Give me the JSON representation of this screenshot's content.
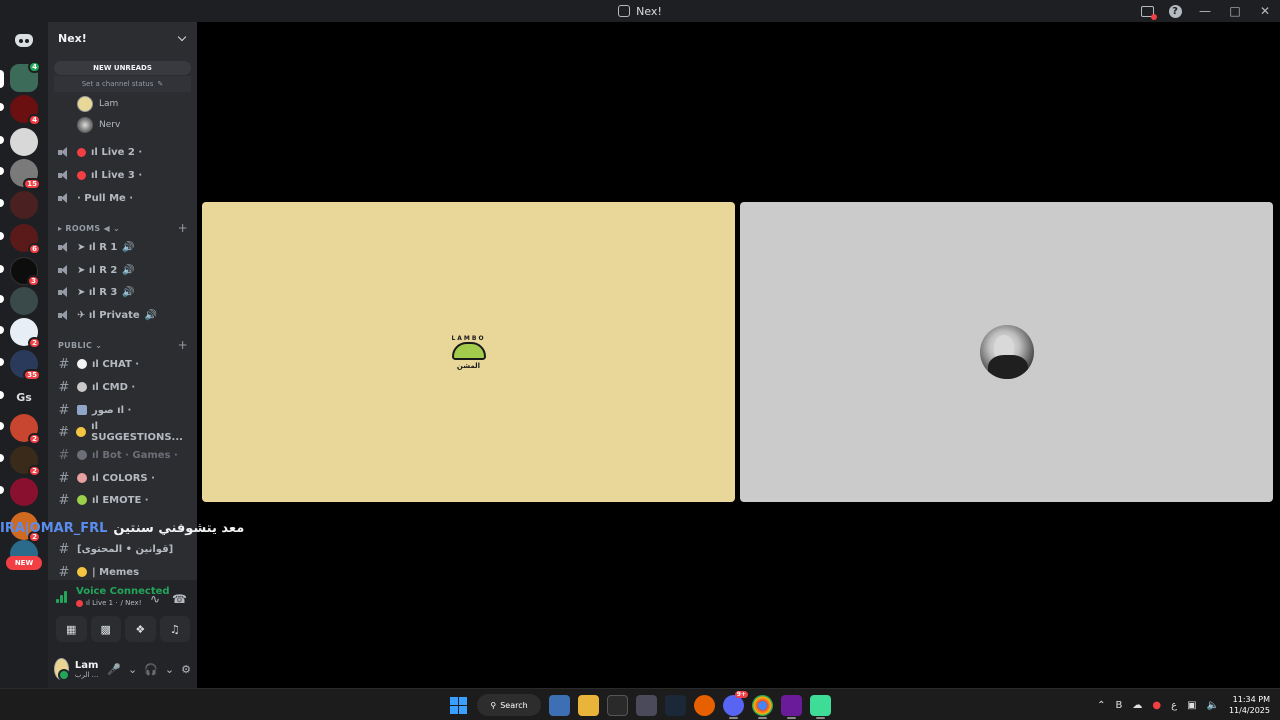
{
  "window": {
    "title": "Nex!"
  },
  "server": {
    "name": "Nex!"
  },
  "sidebar": {
    "new_unreads": "NEW UNREADS",
    "channel_status": "Set a channel status",
    "voice_users": [
      {
        "name": "Lam"
      },
      {
        "name": "Nerv"
      }
    ],
    "voice_channels": [
      {
        "label": "ıl Live 2 ·"
      },
      {
        "label": "ıl Live 3 ·"
      },
      {
        "label": "· Pull Me ·"
      }
    ],
    "rooms_category": "ROOMS ◀",
    "rooms": [
      {
        "label": "➤ ıl R 1"
      },
      {
        "label": "➤ ıl R 2"
      },
      {
        "label": "➤ ıl R 3"
      },
      {
        "label": "✈ ıl Private"
      }
    ],
    "public_category": "PUBLIC",
    "text_channels": [
      {
        "label": "ıl CHAT ·",
        "muted": false
      },
      {
        "label": "ıl CMD ·",
        "muted": false
      },
      {
        "label": "صور ıl ·",
        "muted": false
      },
      {
        "label": "ıl SUGGESTIONS...",
        "muted": false
      },
      {
        "label": "ıl Bot · Games ·",
        "muted": true
      },
      {
        "label": "ıl COLORS ·",
        "muted": false
      },
      {
        "label": "ıl EMOTE ·",
        "muted": false
      },
      {
        "label": "[قوانين • المحتوى]",
        "muted": false
      },
      {
        "label": "| Memes",
        "muted": false
      }
    ]
  },
  "voice_panel": {
    "status": "Voice Connected",
    "channel": "ıl Live 1 ·",
    "server": "/ Nex!"
  },
  "user_panel": {
    "name": "Lam",
    "status": "الرب ..."
  },
  "rail": {
    "badges": [
      "4",
      "4",
      "15",
      "6",
      "3",
      "2",
      "35",
      "2",
      "2",
      "2"
    ],
    "gs_label": "Gs",
    "new_label": "NEW"
  },
  "overlay": {
    "user": "IRA|OMAR_FRL",
    "message": "معد يتشوفني سنتين"
  },
  "stage": {
    "tile_left_user": "Lam",
    "tile_right_user": "Nerv",
    "lamb_arc": "LAMBO",
    "lamb_text": "المشن"
  },
  "taskbar": {
    "search_label": "Search",
    "discord_badge": "9+",
    "time": "11:34 PM",
    "date": "11/4/2025",
    "lang": "ع"
  },
  "colors": {
    "accent_green": "#23a55a",
    "danger_red": "#f23f43",
    "tile_left_bg": "#e9d79a",
    "tile_right_bg": "#cbcbcb"
  }
}
